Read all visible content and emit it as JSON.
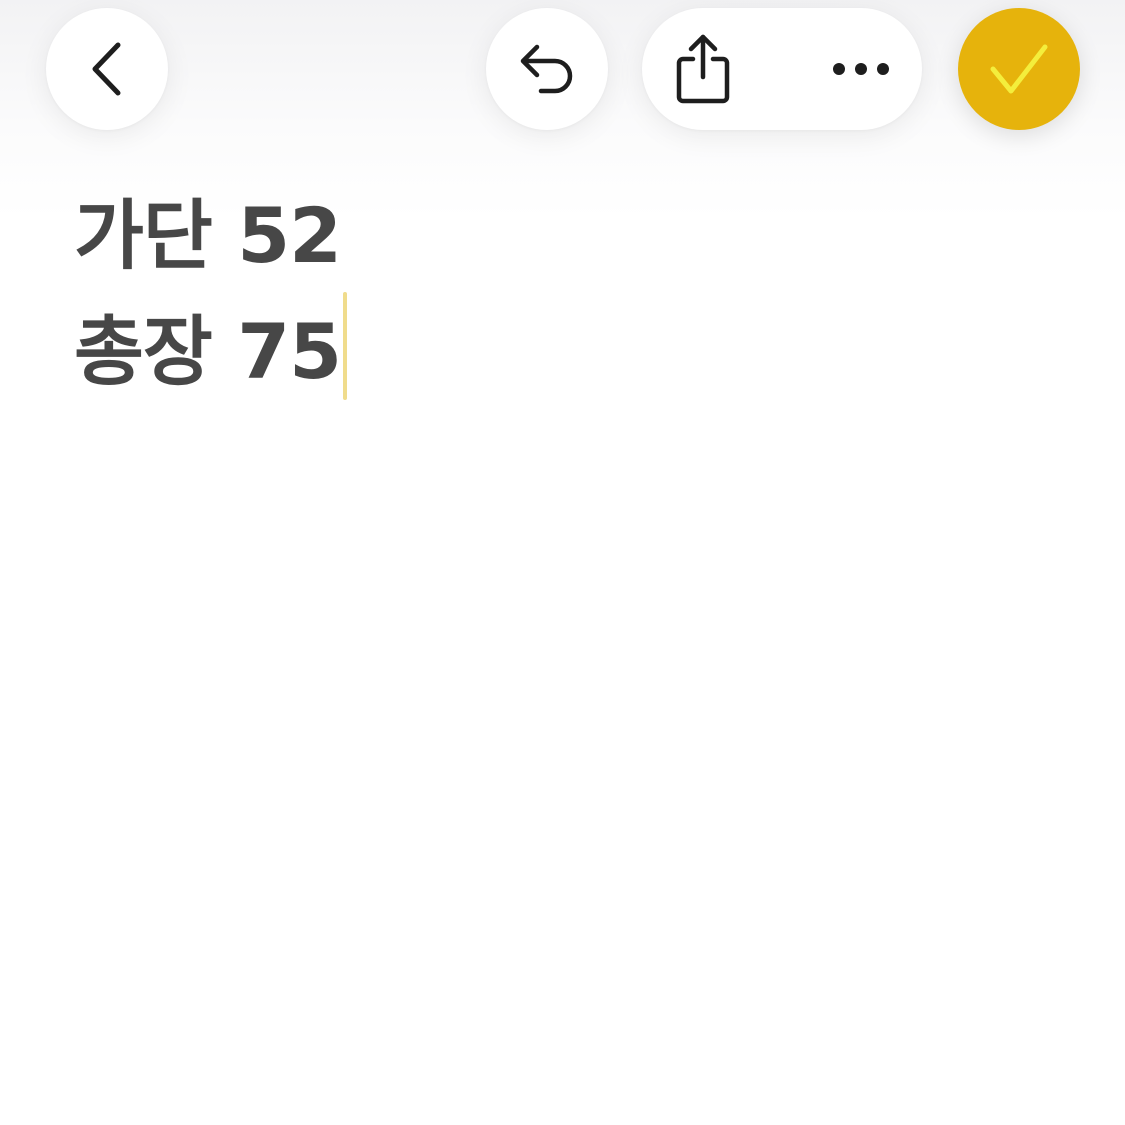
{
  "toolbar": {
    "back_icon": "chevron-left-icon",
    "undo_icon": "undo-icon",
    "share_icon": "share-icon",
    "more_icon": "ellipsis-icon",
    "done_icon": "checkmark-icon",
    "done_color": "#e6b30c",
    "done_check_color": "#f4ee3c"
  },
  "note": {
    "lines": [
      "가단 52",
      "총장 75"
    ],
    "text_color": "#474747",
    "caret_color": "#f0dc8c"
  }
}
